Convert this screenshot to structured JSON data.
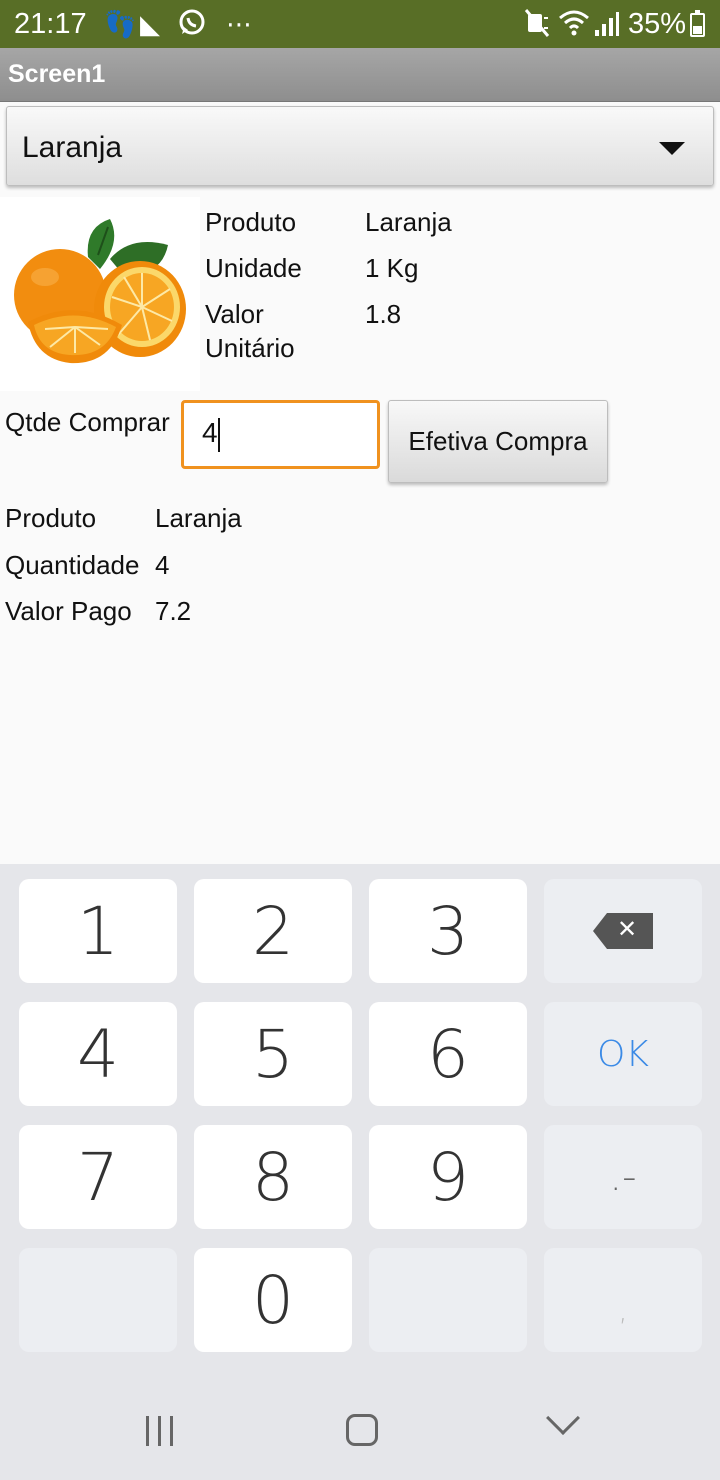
{
  "status_bar": {
    "time": "21:17",
    "battery": "35%",
    "icons": [
      "footsteps-icon",
      "shoe-icon",
      "whatsapp-icon",
      "more-icon",
      "mute-icon",
      "wifi-icon",
      "signal-icon",
      "battery-charging-icon"
    ]
  },
  "app": {
    "title": "Screen1",
    "accent_color": "#586e26"
  },
  "spinner": {
    "selected": "Laranja"
  },
  "product": {
    "image": "orange-fruit-image",
    "rows": [
      {
        "label": "Produto",
        "value": "Laranja"
      },
      {
        "label": "Unidade",
        "value": "1 Kg"
      },
      {
        "label": "Valor\nUnitário",
        "value": "1.8"
      }
    ]
  },
  "purchase": {
    "qty_label": "Qtde Comprar",
    "qty_value": "4",
    "button_label": "Efetiva Compra"
  },
  "result": {
    "rows": [
      {
        "label": "Produto",
        "value": "Laranja"
      },
      {
        "label": "Quantidade",
        "value": "4"
      },
      {
        "label": "Valor Pago",
        "value": "7.2"
      }
    ]
  },
  "keyboard": {
    "keys": [
      "1",
      "2",
      "3",
      "4",
      "5",
      "6",
      "OK",
      "7",
      "8",
      "9",
      ".-",
      "0",
      ","
    ]
  }
}
